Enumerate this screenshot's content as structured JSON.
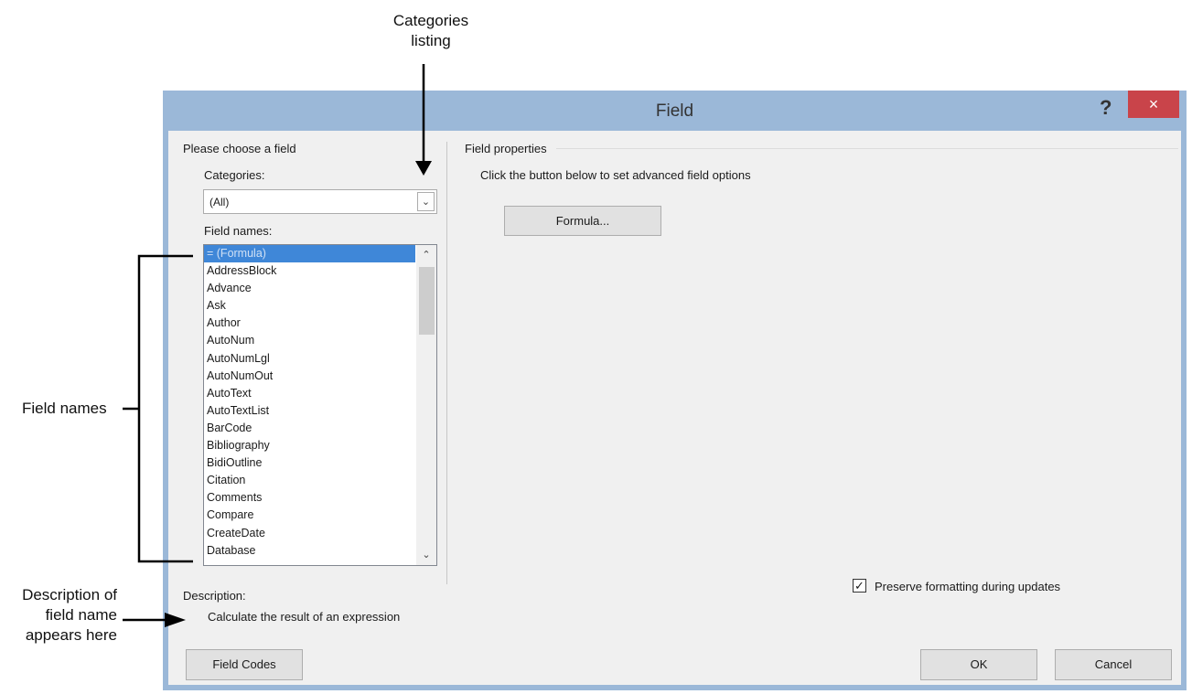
{
  "annotations": {
    "categories_line1": "Categories",
    "categories_line2": "listing",
    "field_names": "Field names",
    "description_line1": "Description of",
    "description_line2": "field name",
    "description_line3": "appears here"
  },
  "dialog": {
    "title": "Field",
    "help_label": "?",
    "close_label": "×"
  },
  "left": {
    "group_label": "Please choose a field",
    "categories_label": "Categories:",
    "categories_value": "(All)",
    "field_names_label": "Field names:",
    "field_names": [
      "= (Formula)",
      "AddressBlock",
      "Advance",
      "Ask",
      "Author",
      "AutoNum",
      "AutoNumLgl",
      "AutoNumOut",
      "AutoText",
      "AutoTextList",
      "BarCode",
      "Bibliography",
      "BidiOutline",
      "Citation",
      "Comments",
      "Compare",
      "CreateDate",
      "Database"
    ],
    "selected_field": "= (Formula)",
    "description_label": "Description:",
    "description_text": "Calculate the result of an expression",
    "field_codes_button": "Field Codes"
  },
  "right": {
    "group_label": "Field properties",
    "instruction": "Click the button below to set advanced field options",
    "formula_button": "Formula...",
    "preserve_label": "Preserve formatting during updates",
    "preserve_checked": true
  },
  "buttons": {
    "ok": "OK",
    "cancel": "Cancel"
  },
  "icons": {
    "combo_arrow": "chevron-down-icon",
    "scroll_up": "chevron-up-icon",
    "scroll_down": "chevron-down-icon",
    "check": "checkmark-icon"
  }
}
